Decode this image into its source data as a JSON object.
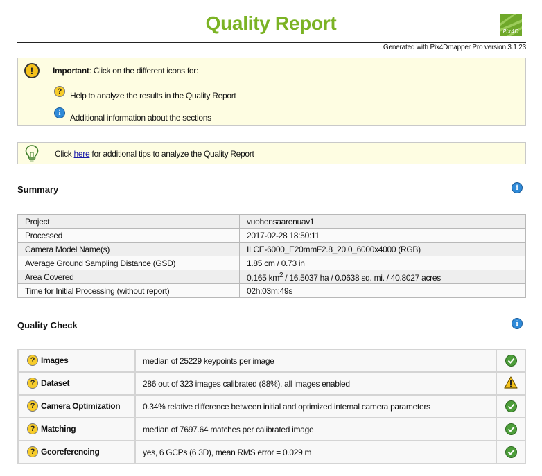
{
  "header": {
    "title": "Quality Report",
    "logo_text": "Pix4D",
    "generated": "Generated with Pix4Dmapper Pro version 3.1.23"
  },
  "important": {
    "label": "Important",
    "text": ": Click on the different icons for:",
    "help_line": "Help to analyze the results in the Quality Report",
    "info_line": "Additional information about the sections"
  },
  "tip": {
    "prefix": "Click ",
    "link": "here",
    "suffix": " for additional tips to analyze the Quality Report"
  },
  "summary": {
    "title": "Summary",
    "rows": [
      {
        "key": "Project",
        "value": "vuohensaarenuav1"
      },
      {
        "key": "Processed",
        "value": "2017-02-28 18:50:11"
      },
      {
        "key": "Camera Model Name(s)",
        "value": "ILCE-6000_E20mmF2.8_20.0_6000x4000 (RGB)"
      },
      {
        "key": "Average Ground Sampling Distance (GSD)",
        "value": "1.85 cm / 0.73 in"
      },
      {
        "key": "Area Covered",
        "value_a": "0.165 km",
        "value_sup": "2",
        "value_b": " / 16.5037 ha / 0.0638 sq. mi. / 40.8027 acres"
      },
      {
        "key": "Time for Initial Processing (without report)",
        "value": "02h:03m:49s"
      }
    ]
  },
  "quality": {
    "title": "Quality Check",
    "rows": [
      {
        "name": "Images",
        "text": "median of 25229 keypoints per image",
        "status": "ok"
      },
      {
        "name": "Dataset",
        "text": "286 out of 323 images calibrated (88%), all images enabled",
        "status": "warning"
      },
      {
        "name": "Camera Optimization",
        "text": "0.34% relative difference between initial and optimized internal camera parameters",
        "status": "ok"
      },
      {
        "name": "Matching",
        "text": "median of 7697.64 matches per calibrated image",
        "status": "ok"
      },
      {
        "name": "Georeferencing",
        "text": "yes, 6 GCPs (6 3D), mean RMS error = 0.029 m",
        "status": "ok"
      }
    ]
  },
  "icons": {
    "help": "?",
    "info": "i",
    "important": "!"
  },
  "colors": {
    "title_green": "#7bb324",
    "box_bg": "#fefde2",
    "ok_green": "#4d9e3a",
    "warning_yellow": "#f5c21b",
    "info_blue": "#2f8ad8"
  }
}
